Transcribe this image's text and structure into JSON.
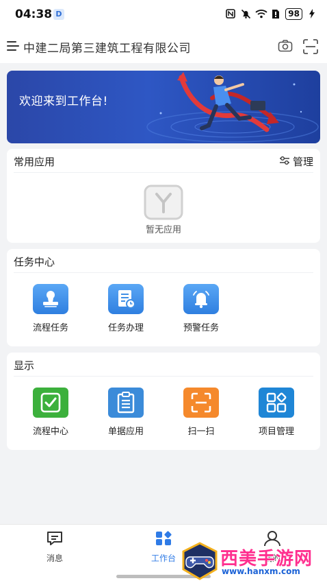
{
  "status_bar": {
    "time": "04:38",
    "app_badge": "D",
    "icons": [
      "nfc-icon",
      "mute-icon",
      "wifi-icon",
      "sim-icon"
    ],
    "battery": "98"
  },
  "header": {
    "company": "中建二局第三建筑工程有限公司",
    "icons": [
      "menu-icon",
      "camera-icon",
      "scan-icon"
    ]
  },
  "banner": {
    "text": "欢迎来到工作台!"
  },
  "common_apps": {
    "title": "常用应用",
    "manage_label": "管理",
    "empty_text": "暂无应用"
  },
  "task_center": {
    "title": "任务中心",
    "items": [
      {
        "label": "流程任务",
        "icon": "stamp-icon",
        "color": "#3f8fe6"
      },
      {
        "label": "任务办理",
        "icon": "document-clock-icon",
        "color": "#3f8fe6"
      },
      {
        "label": "预警任务",
        "icon": "bell-icon",
        "color": "#3f8fe6"
      }
    ]
  },
  "display": {
    "title": "显示",
    "items": [
      {
        "label": "流程中心",
        "icon": "checkbox-icon",
        "color": "#3cb03c"
      },
      {
        "label": "单据应用",
        "icon": "clipboard-icon",
        "color": "#3b8bd9"
      },
      {
        "label": "扫一扫",
        "icon": "scan-frame-icon",
        "color": "#f5892c"
      },
      {
        "label": "项目管理",
        "icon": "grid-apps-icon",
        "color": "#1f86d6"
      }
    ]
  },
  "tabbar": {
    "items": [
      {
        "label": "消息",
        "icon": "message-icon",
        "active": false
      },
      {
        "label": "工作台",
        "icon": "workbench-icon",
        "active": true
      },
      {
        "label": "我的",
        "icon": "profile-icon",
        "active": false
      }
    ],
    "active_color": "#2f7be6"
  },
  "watermark": {
    "title": "西美手游网",
    "url": "www.hanxm.com"
  }
}
